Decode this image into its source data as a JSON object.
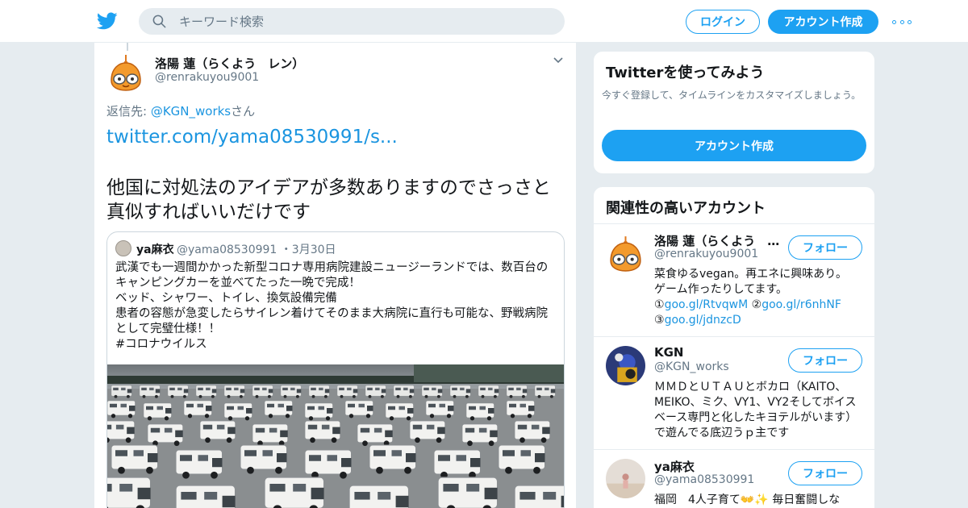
{
  "header": {
    "search_placeholder": "キーワード検索",
    "login_label": "ログイン",
    "signup_label": "アカウント作成"
  },
  "tweet": {
    "author_name": "洛陽 蓮（らくよう　レン）",
    "author_handle": "@renrakuyou9001",
    "reply_prefix": "返信先: ",
    "reply_handle": "@KGN_works",
    "reply_suffix": "さん",
    "link": "twitter.com/yama08530991/s...",
    "text": "他国に対処法のアイデアが多数ありますのでさっさと真似すればいいだけです",
    "quote": {
      "author_name": "ya麻衣",
      "author_handle": "@yama08530991",
      "date": "・3月30日",
      "lines": [
        "武漢でも一週間かかった新型コロナ専用病院建設ニュージーランドでは、数百台のキャンピングカーを並べてたった一晩で完成！",
        "ベッド、シャワー、トイレ、換気設備完備",
        "患者の容態が急変したらサイレン着けてそのまま大病院に直行も可能な、野戦病院として完璧仕様！！",
        "#コロナウイルス"
      ]
    }
  },
  "signup_card": {
    "title": "Twitterを使ってみよう",
    "description": "今すぐ登録して、タイムラインをカスタマイズしましょう。",
    "button_label": "アカウント作成"
  },
  "related": {
    "title": "関連性の高いアカウント",
    "follow_label": "フォロー",
    "accounts": [
      {
        "name": "洛陽 蓮（らくよう　…",
        "handle": "@renrakuyou9001",
        "bio_line1": "菜食ゆるvegan。再エネに興味あり。",
        "bio_line2": "ゲーム作ったりしてます。",
        "bio_line3a": "①",
        "bio_link1": "goo.gl/RtvqwM",
        "bio_line3b": " ②",
        "bio_link2": "goo.gl/r6nhNF",
        "bio_line4a": "③",
        "bio_link3": "goo.gl/jdnzcD"
      },
      {
        "name": "KGN",
        "handle": "@KGN_works",
        "bio": "ＭＭＤとＵＴＡＵとボカロ（KAITO、MEIKO、ミク、VY1、VY2そしてボイスベース専門と化したキヨテルがいます）で遊んでる底辺うｐ主です"
      },
      {
        "name": "ya麻衣",
        "handle": "@yama08530991",
        "bio": "福岡　4人子育て👐✨ 毎日奮闘しな"
      }
    ]
  }
}
